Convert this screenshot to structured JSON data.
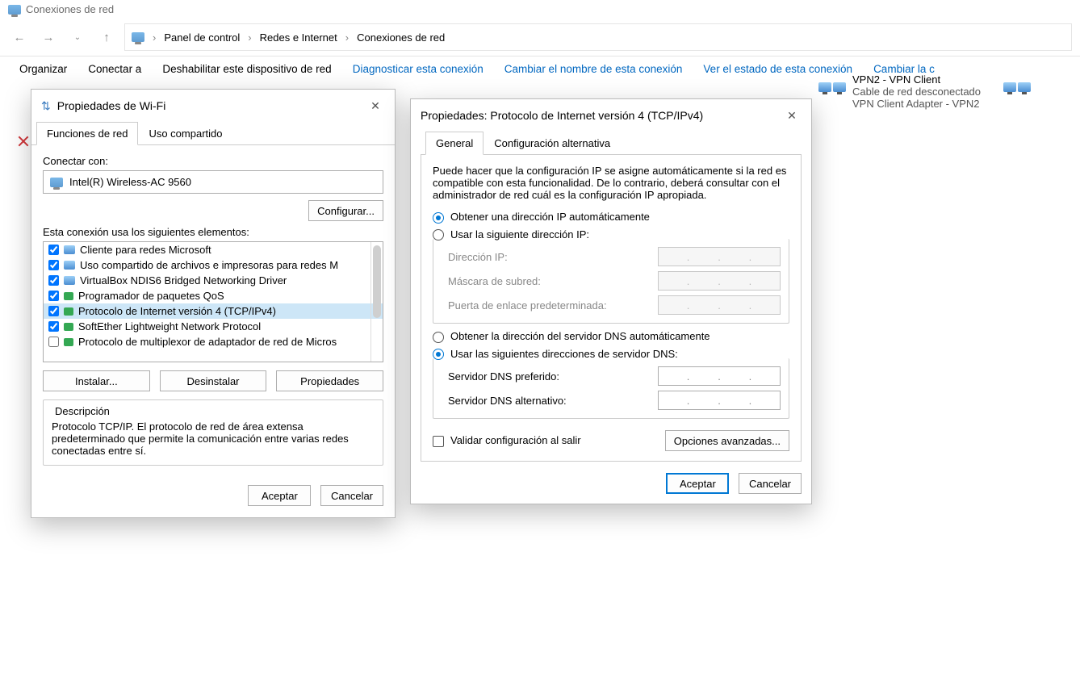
{
  "window_title": "Conexiones de red",
  "breadcrumb": [
    "Panel de control",
    "Redes e Internet",
    "Conexiones de red"
  ],
  "cmdbar": [
    "Organizar",
    "Conectar a",
    "Deshabilitar este dispositivo de red",
    "Diagnosticar esta conexión",
    "Cambiar el nombre de esta conexión",
    "Ver el estado de esta conexión",
    "Cambiar la c"
  ],
  "vpn_item": {
    "name": "VPN2 - VPN Client",
    "status": "Cable de red desconectado",
    "adapter": "VPN Client Adapter - VPN2"
  },
  "wifi_dialog": {
    "title": "Propiedades de Wi-Fi",
    "tabs": [
      "Funciones de red",
      "Uso compartido"
    ],
    "connect_with": "Conectar con:",
    "adapter": "Intel(R) Wireless-AC 9560",
    "configure_btn": "Configurar...",
    "uses_label": "Esta conexión usa los siguientes elementos:",
    "items": [
      {
        "checked": true,
        "label": "Cliente para redes Microsoft",
        "ico": "mon"
      },
      {
        "checked": true,
        "label": "Uso compartido de archivos e impresoras para redes M",
        "ico": "mon"
      },
      {
        "checked": true,
        "label": "VirtualBox NDIS6 Bridged Networking Driver",
        "ico": "mon"
      },
      {
        "checked": true,
        "label": "Programador de paquetes QoS",
        "ico": "green"
      },
      {
        "checked": true,
        "label": "Protocolo de Internet versión 4 (TCP/IPv4)",
        "ico": "green",
        "selected": true
      },
      {
        "checked": true,
        "label": "SoftEther Lightweight Network Protocol",
        "ico": "green"
      },
      {
        "checked": false,
        "label": "Protocolo de multiplexor de adaptador de red de Micros",
        "ico": "green"
      }
    ],
    "install_btn": "Instalar...",
    "uninstall_btn": "Desinstalar",
    "properties_btn": "Propiedades",
    "desc_title": "Descripción",
    "desc_text": "Protocolo TCP/IP. El protocolo de red de área extensa predeterminado que permite la comunicación entre varias redes conectadas entre sí.",
    "accept": "Aceptar",
    "cancel": "Cancelar"
  },
  "ipv4_dialog": {
    "title": "Propiedades: Protocolo de Internet versión 4 (TCP/IPv4)",
    "tabs": [
      "General",
      "Configuración alternativa"
    ],
    "intro": "Puede hacer que la configuración IP se asigne automáticamente si la red es compatible con esta funcionalidad. De lo contrario, deberá consultar con el administrador de red cuál es la configuración IP apropiada.",
    "ip_auto": "Obtener una dirección IP automáticamente",
    "ip_manual": "Usar la siguiente dirección IP:",
    "ip_fields": {
      "ip": "Dirección IP:",
      "mask": "Máscara de subred:",
      "gw": "Puerta de enlace predeterminada:"
    },
    "dns_auto": "Obtener la dirección del servidor DNS automáticamente",
    "dns_manual": "Usar las siguientes direcciones de servidor DNS:",
    "dns_fields": {
      "pref": "Servidor DNS preferido:",
      "alt": "Servidor DNS alternativo:"
    },
    "validate": "Validar configuración al salir",
    "advanced": "Opciones avanzadas...",
    "accept": "Aceptar",
    "cancel": "Cancelar"
  }
}
